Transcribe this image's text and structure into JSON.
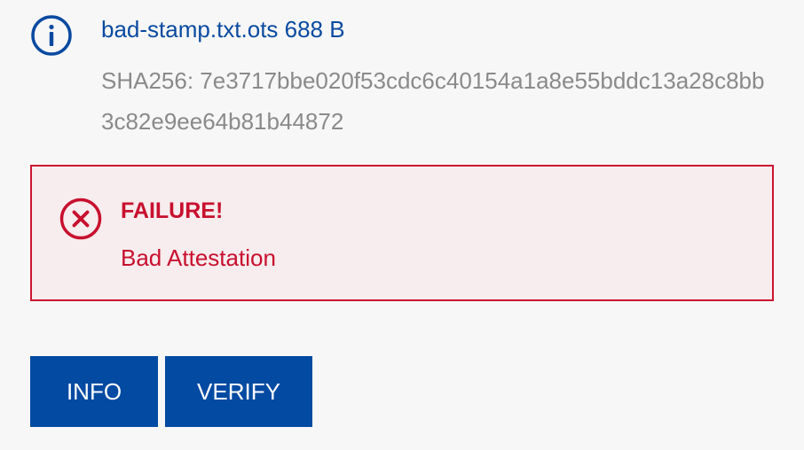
{
  "file": {
    "icon": "info-icon",
    "name": "bad-stamp.txt.ots",
    "size": "688 B",
    "name_and_size": "bad-stamp.txt.ots 688 B",
    "hash_label": "SHA256:",
    "hash_value": "7e3717bbe020f53cdc6c40154a1a8e55bddc13a28c8bb3c82e9ee64b81b44872",
    "hash_line": "SHA256: 7e3717bbe020f53cdc6c40154a1a8e55bddc13a28c8bb3c82e9ee64b81b44872"
  },
  "alert": {
    "icon": "error-circle-x-icon",
    "title": "FAILURE!",
    "message": "Bad Attestation",
    "color": "#c8102e",
    "background": "#f7ecee"
  },
  "buttons": {
    "info_label": "INFO",
    "verify_label": "VERIFY",
    "color": "#034aa2"
  },
  "colors": {
    "link_blue": "#0a4aa0",
    "muted_text": "#8a8a8a",
    "page_background": "#f7f7f7"
  }
}
